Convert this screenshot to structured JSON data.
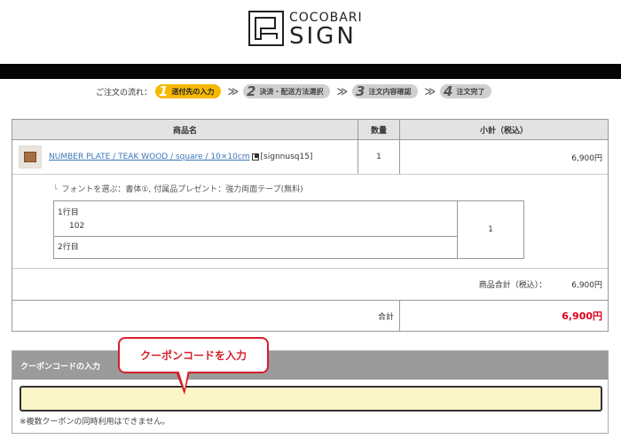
{
  "logo": {
    "top_text": "COCOBARI",
    "bottom_text": "SIGN"
  },
  "steps": {
    "label": "ご注文の流れ：",
    "items": [
      {
        "num": "1",
        "label": "送付先の入力",
        "active": true
      },
      {
        "num": "2",
        "label": "決済・配送方法選択",
        "active": false
      },
      {
        "num": "3",
        "label": "注文内容確認",
        "active": false
      },
      {
        "num": "4",
        "label": "注文完了",
        "active": false
      }
    ],
    "separator": "≫"
  },
  "cart": {
    "headers": {
      "product": "商品名",
      "quantity": "数量",
      "subtotal": "小計（税込）"
    },
    "product": {
      "name": "NUMBER PLATE / TEAK WOOD / square / 10×10cm",
      "sku": "[signnusq15]",
      "quantity": "1",
      "price": "6,900円"
    },
    "options_line": "フォントを選ぶ：書体①, 付属品プレゼント：強力両面テープ(無料)",
    "options_tree_mark": "└",
    "lines": {
      "line1_label": "1行目",
      "line1_value": "102",
      "line2_label": "2行目",
      "qty": "1"
    },
    "subtotal_label": "商品合計（税込）：",
    "subtotal_value": "6,900円",
    "total_label": "合計",
    "total_value": "6,900円"
  },
  "coupon": {
    "title": "クーポンコードの入力",
    "input_value": "",
    "note": "※複数クーポンの同時利用はできません。"
  },
  "callout": {
    "text": "クーポンコードを入力"
  },
  "colors": {
    "accent": "#f6b900",
    "price_red": "#e0001b",
    "callout_red": "#d6202b",
    "link": "#3a74b8"
  }
}
